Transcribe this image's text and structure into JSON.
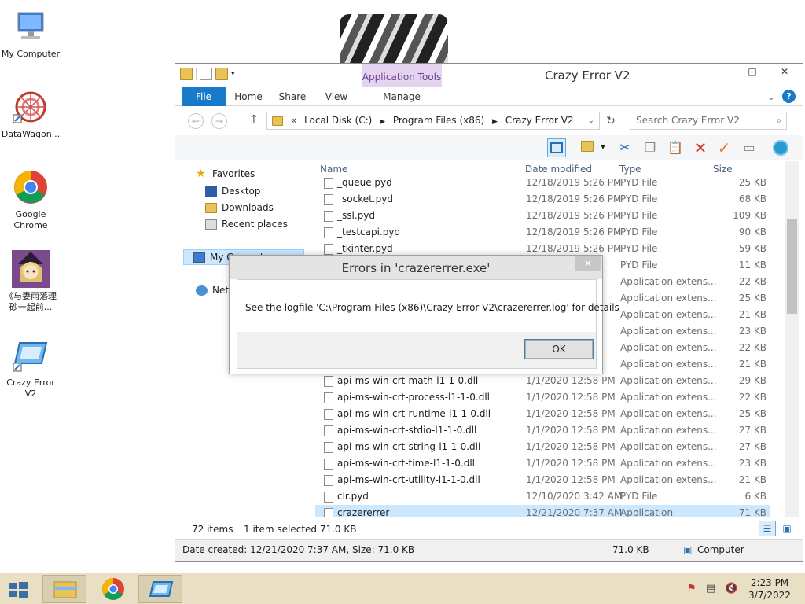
{
  "desktop": {
    "icons": [
      {
        "label": "My Computer",
        "icon": "my-computer-icon"
      },
      {
        "label": "DataWagon...",
        "icon": "datawagon-icon"
      },
      {
        "label": "Google Chrome",
        "icon": "chrome-icon"
      },
      {
        "label": "《与妻雨落理 砂一起前...",
        "icon": "anime-character-icon"
      },
      {
        "label": "Crazy Error V2",
        "icon": "crazy-error-icon"
      }
    ]
  },
  "explorer": {
    "title": "Crazy Error V2",
    "context_tab": "Application Tools",
    "tabs": [
      "File",
      "Home",
      "Share",
      "View",
      "Manage"
    ],
    "address": {
      "root_marker": "«",
      "crumbs": [
        "Local Disk (C:)",
        "Program Files (x86)",
        "Crazy Error V2"
      ]
    },
    "search_placeholder": "Search Crazy Error V2",
    "nav": {
      "favorites": "Favorites",
      "items": [
        "Desktop",
        "Downloads",
        "Recent places"
      ],
      "computer": "My Computer",
      "network": "Network"
    },
    "columns": [
      "Name",
      "Date modified",
      "Type",
      "Size"
    ],
    "files": [
      {
        "name": "_queue.pyd",
        "date": "12/18/2019 5:26 PM",
        "type": "PYD File",
        "size": "25 KB"
      },
      {
        "name": "_socket.pyd",
        "date": "12/18/2019 5:26 PM",
        "type": "PYD File",
        "size": "68 KB"
      },
      {
        "name": "_ssl.pyd",
        "date": "12/18/2019 5:26 PM",
        "type": "PYD File",
        "size": "109 KB"
      },
      {
        "name": "_testcapi.pyd",
        "date": "12/18/2019 5:26 PM",
        "type": "PYD File",
        "size": "90 KB"
      },
      {
        "name": "_tkinter.pyd",
        "date": "12/18/2019 5:26 PM",
        "type": "PYD File",
        "size": "59 KB"
      },
      {
        "name": "",
        "date": "",
        "type": "PYD File",
        "size": "11 KB"
      },
      {
        "name": "",
        "date": "",
        "type": "Application extens...",
        "size": "22 KB"
      },
      {
        "name": "",
        "date": "",
        "type": "Application extens...",
        "size": "25 KB"
      },
      {
        "name": "",
        "date": "",
        "type": "Application extens...",
        "size": "21 KB"
      },
      {
        "name": "",
        "date": "",
        "type": "Application extens...",
        "size": "23 KB"
      },
      {
        "name": "",
        "date": "",
        "type": "Application extens...",
        "size": "22 KB"
      },
      {
        "name": "",
        "date": "",
        "type": "Application extens...",
        "size": "21 KB"
      },
      {
        "name": "api-ms-win-crt-math-l1-1-0.dll",
        "date": "1/1/2020 12:58 PM",
        "type": "Application extens...",
        "size": "29 KB"
      },
      {
        "name": "api-ms-win-crt-process-l1-1-0.dll",
        "date": "1/1/2020 12:58 PM",
        "type": "Application extens...",
        "size": "22 KB"
      },
      {
        "name": "api-ms-win-crt-runtime-l1-1-0.dll",
        "date": "1/1/2020 12:58 PM",
        "type": "Application extens...",
        "size": "25 KB"
      },
      {
        "name": "api-ms-win-crt-stdio-l1-1-0.dll",
        "date": "1/1/2020 12:58 PM",
        "type": "Application extens...",
        "size": "27 KB"
      },
      {
        "name": "api-ms-win-crt-string-l1-1-0.dll",
        "date": "1/1/2020 12:58 PM",
        "type": "Application extens...",
        "size": "27 KB"
      },
      {
        "name": "api-ms-win-crt-time-l1-1-0.dll",
        "date": "1/1/2020 12:58 PM",
        "type": "Application extens...",
        "size": "23 KB"
      },
      {
        "name": "api-ms-win-crt-utility-l1-1-0.dll",
        "date": "1/1/2020 12:58 PM",
        "type": "Application extens...",
        "size": "21 KB"
      },
      {
        "name": "clr.pyd",
        "date": "12/10/2020 3:42 AM",
        "type": "PYD File",
        "size": "6 KB"
      },
      {
        "name": "crazererrer",
        "date": "12/21/2020 7:37 AM",
        "type": "Application",
        "size": "71 KB"
      }
    ],
    "status": {
      "items_count": "72 items",
      "selected": "1 item selected  71.0 KB",
      "details": "Date created: 12/21/2020 7:37 AM, Size: 71.0 KB",
      "size": "71.0 KB",
      "location": "Computer"
    }
  },
  "dialog": {
    "title": "Errors in 'crazererrer.exe'",
    "message": "See the logfile 'C:\\Program Files (x86)\\Crazy Error V2\\crazererrer.log' for details",
    "ok": "OK"
  },
  "taskbar": {
    "time": "2:23 PM",
    "date": "3/7/2022"
  },
  "colors": {
    "accent": "#1979ca",
    "selection": "#cce8ff",
    "app_tools": "#e5d4f0",
    "taskbar": "#e8dfc4"
  }
}
